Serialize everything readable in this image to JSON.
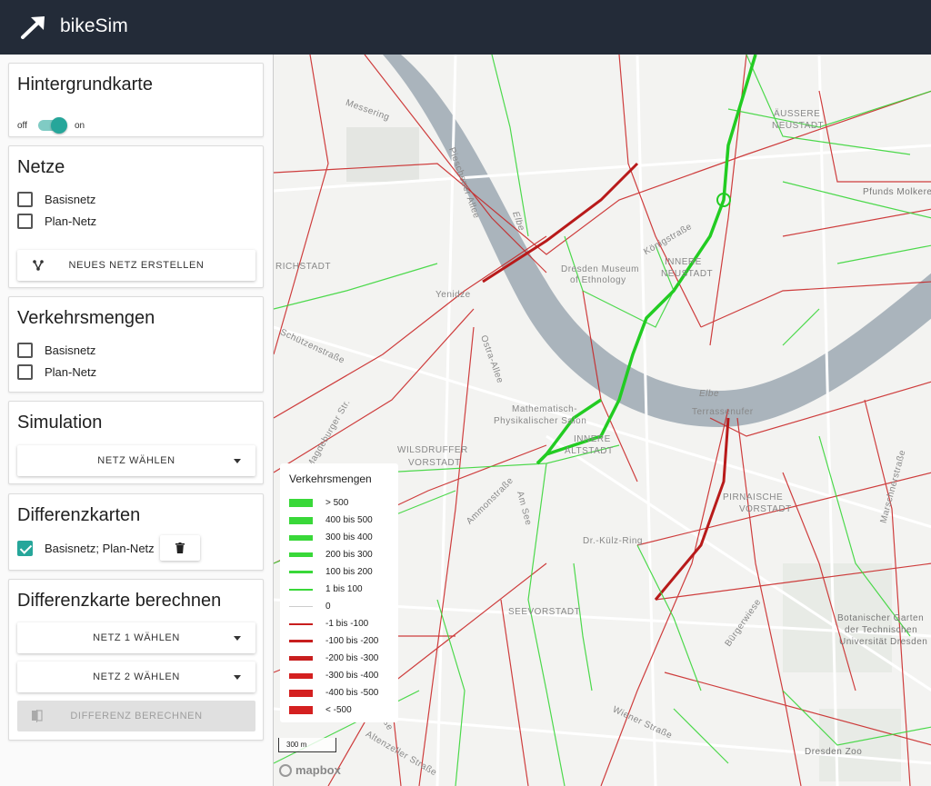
{
  "app": {
    "title": "bikeSim"
  },
  "sidebar": {
    "hintergrund": {
      "title": "Hintergrundkarte",
      "off_label": "off",
      "on_label": "on",
      "enabled": true
    },
    "netze": {
      "title": "Netze",
      "items": [
        {
          "label": "Basisnetz",
          "checked": false
        },
        {
          "label": "Plan-Netz",
          "checked": false
        }
      ],
      "create_button": "NEUES NETZ ERSTELLEN"
    },
    "verkehr": {
      "title": "Verkehrsmengen",
      "items": [
        {
          "label": "Basisnetz",
          "checked": false
        },
        {
          "label": "Plan-Netz",
          "checked": false
        }
      ]
    },
    "simulation": {
      "title": "Simulation",
      "select_label": "NETZ WÄHLEN"
    },
    "differenz": {
      "title": "Differenzkarten",
      "items": [
        {
          "label": "Basisnetz; Plan-Netz",
          "checked": true
        }
      ]
    },
    "berechnen": {
      "title": "Differenzkarte berechnen",
      "net1_label": "NETZ 1 WÄHLEN",
      "net2_label": "NETZ 2 WÄHLEN",
      "compute_button": "DIFFERENZ BERECHNEN"
    }
  },
  "map": {
    "labels": [
      "ÄUSSERE",
      "NEUSTADT",
      "INNERE",
      "NEUSTADT",
      "RICHSTADT",
      "Yenidze",
      "Dresden Museum",
      "of Ethnology",
      "Mathematisch-",
      "Physikalischer Salon",
      "WILSDRUFFER",
      "VORSTADT",
      "INNERE",
      "ALTSTADT",
      "PIRNAISCHE",
      "VORSTADT",
      "SEEVORSTADT",
      "Botanischer Garten",
      "der Technischen",
      "Universität Dresden",
      "Dresden Zoo",
      "Pfunds Molkerei",
      "Elbe",
      "Elbe",
      "Terrassenufer",
      "Messering",
      "Dr.-Külz-Ring",
      "Königstraße",
      "Marschnerstraße",
      "Ammonstraße",
      "Am See",
      "Wiener Straße",
      "Ostra-Allee",
      "Bürgerwiese",
      "Altenzeller Straße",
      "Schützenstraße",
      "Magdeburger Str.",
      "Weißeritzstraße",
      "Pieschener Allee"
    ],
    "scale": "300 m",
    "attribution": "mapbox",
    "colors": {
      "positive": "#2ecc2e",
      "negative": "#c81e1e",
      "river": "#aab4bc",
      "zero": "#cccccc"
    }
  },
  "legend": {
    "title": "Verkehrsmengen",
    "items": [
      {
        "label": "> 500",
        "color": "#39d839"
      },
      {
        "label": "400 bis 500",
        "color": "#39d839"
      },
      {
        "label": "300 bis 400",
        "color": "#39d839"
      },
      {
        "label": "200 bis 300",
        "color": "#39d839"
      },
      {
        "label": "100 bis 200",
        "color": "#39d839"
      },
      {
        "label": "1 bis 100",
        "color": "#39d839"
      },
      {
        "label": "0",
        "color": "#cccccc"
      },
      {
        "label": "-1 bis -100",
        "color": "#c81e1e"
      },
      {
        "label": "-100 bis -200",
        "color": "#c81e1e"
      },
      {
        "label": "-200 bis -300",
        "color": "#c81e1e"
      },
      {
        "label": "-300 bis -400",
        "color": "#d42020"
      },
      {
        "label": "-400 bis -500",
        "color": "#d42020"
      },
      {
        "label": "< -500",
        "color": "#d42020"
      }
    ]
  }
}
